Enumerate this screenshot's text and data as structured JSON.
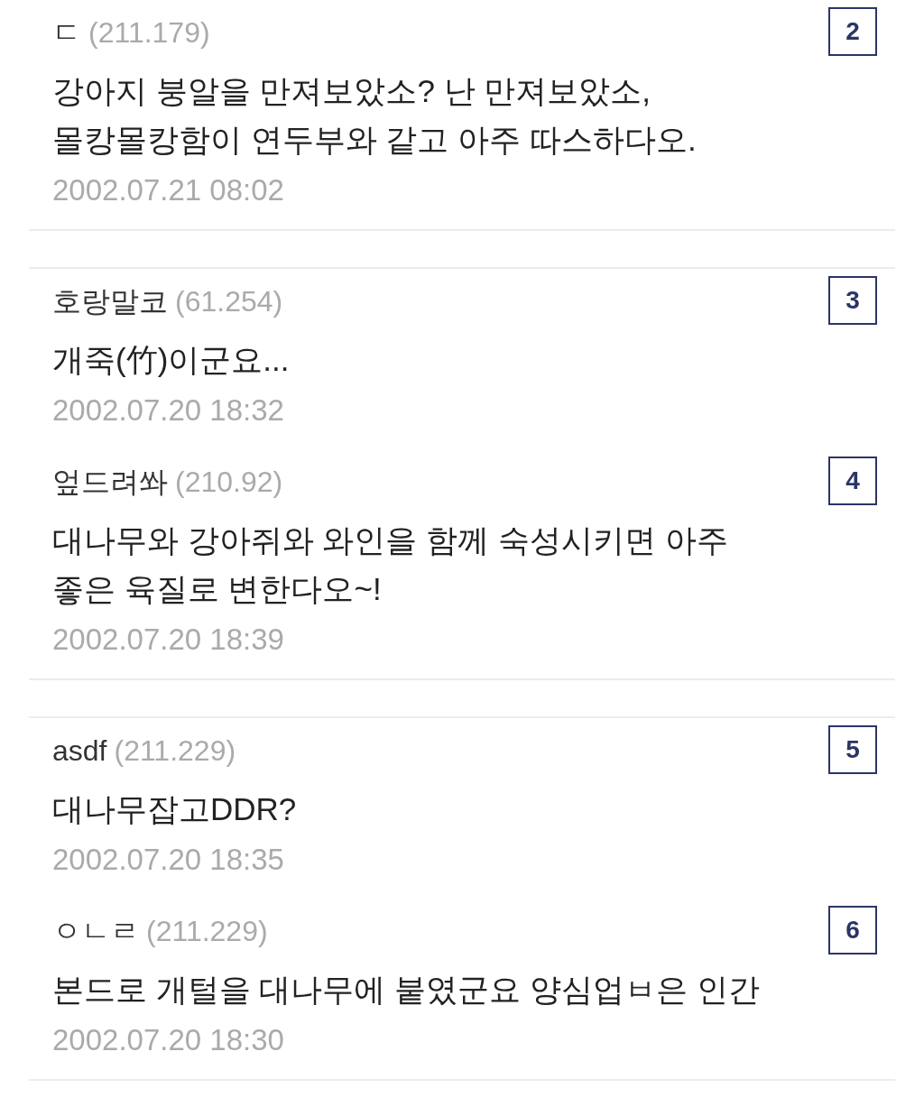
{
  "comments": [
    {
      "author": "ㄷ",
      "ip": "(211.179)",
      "lines": [
        "강아지 붕알을 만져보았소? 난 만져보았소,",
        "몰캉몰캉함이 연두부와 같고 아주 따스하다오."
      ],
      "date": "2002.07.21 08:02",
      "badge": "2",
      "divider": true
    },
    {
      "author": "호랑말코",
      "ip": "(61.254)",
      "lines": [
        "개죽(竹)이군요..."
      ],
      "date": "2002.07.20 18:32",
      "badge": "3",
      "divider": false
    },
    {
      "author": "엎드려쏴",
      "ip": "(210.92)",
      "lines": [
        "대나무와 강아쥐와 와인을 함께 숙성시키면 아주",
        "좋은 육질로 변한다오~!"
      ],
      "date": "2002.07.20 18:39",
      "badge": "4",
      "divider": true
    },
    {
      "author": "asdf",
      "ip": "(211.229)",
      "lines": [
        "대나무잡고DDR?"
      ],
      "date": "2002.07.20 18:35",
      "badge": "5",
      "divider": false
    },
    {
      "author": "ㅇㄴㄹ",
      "ip": "(211.229)",
      "lines": [
        "본드로 개털을 대나무에 붙였군요 양심업ㅂ은 인간"
      ],
      "date": "2002.07.20 18:30",
      "badge": "6",
      "divider": true
    }
  ]
}
